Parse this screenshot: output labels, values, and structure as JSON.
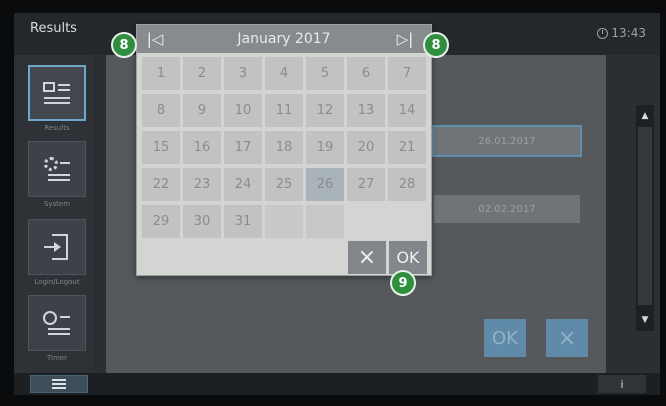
{
  "topbar": {
    "title": "Results",
    "time": "13:43"
  },
  "sidebar": {
    "items": [
      {
        "label": "Results",
        "icon": "results-icon"
      },
      {
        "label": "System",
        "icon": "system-icon"
      },
      {
        "label": "Login/Logout",
        "icon": "login-logout-icon"
      },
      {
        "label": "Timer",
        "icon": "timer-icon"
      }
    ]
  },
  "content": {
    "date_from": "26.01.2017",
    "date_to": "02.02.2017",
    "ok_label": "OK",
    "cancel_label": "×"
  },
  "calendar": {
    "title": "January 2017",
    "prev_label": "|◁",
    "next_label": "▷|",
    "days": [
      [
        "1",
        "2",
        "3",
        "4",
        "5",
        "6",
        "7"
      ],
      [
        "8",
        "9",
        "10",
        "11",
        "12",
        "13",
        "14"
      ],
      [
        "15",
        "16",
        "17",
        "18",
        "19",
        "20",
        "21"
      ],
      [
        "22",
        "23",
        "24",
        "25",
        "26",
        "27",
        "28"
      ],
      [
        "29",
        "30",
        "31",
        "",
        "",
        "",
        ""
      ]
    ],
    "selected_day": "26",
    "cancel_label": "×",
    "ok_label": "OK"
  },
  "callouts": {
    "prev": "8",
    "next": "8",
    "ok": "9"
  },
  "bottombar": {
    "info_label": "i"
  },
  "colors": {
    "accent": "#5f8aa8",
    "callout": "#2f8f3f"
  }
}
